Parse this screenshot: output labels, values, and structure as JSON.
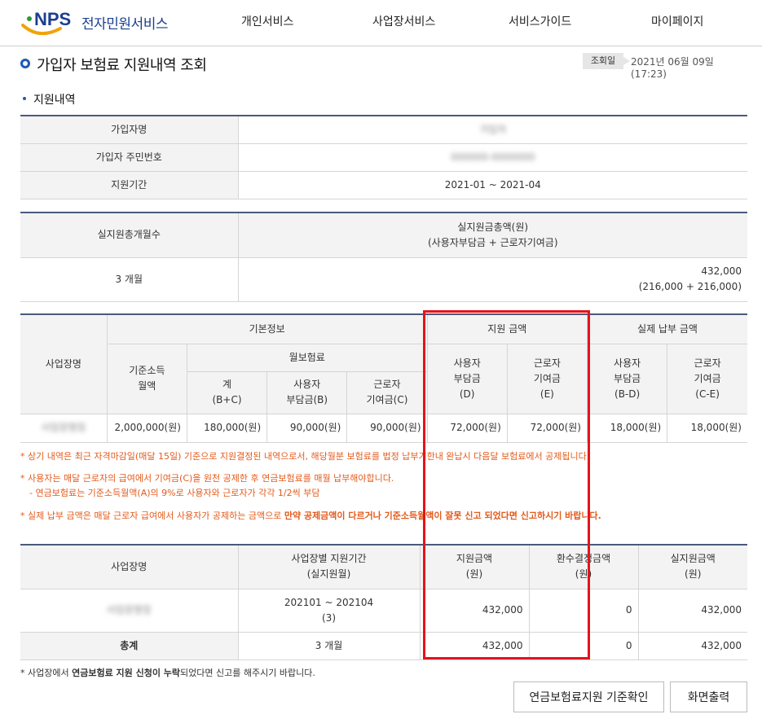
{
  "header": {
    "logo_text": "NPS",
    "service_name": "전자민원서비스",
    "nav": [
      "개인서비스",
      "사업장서비스",
      "서비스가이드",
      "마이페이지"
    ]
  },
  "page": {
    "title": "가입자 보험료 지원내역 조회",
    "query_label": "조회일",
    "query_date": "2021년 06월 09일 (17:23)",
    "section_title": "지원내역"
  },
  "info": {
    "name_label": "가입자명",
    "name_value": "가입자",
    "id_label": "가입자 주민번호",
    "id_value": "000000-0000000",
    "period_label": "지원기간",
    "period_value": "2021-01 ~ 2021-04"
  },
  "summary": {
    "months_header": "실지원총개월수",
    "total_header_1": "실지원금총액(원)",
    "total_header_2": "(사용자부담금 + 근로자기여금)",
    "months_value": "3 개월",
    "total_value_1": "432,000",
    "total_value_2": "(216,000 + 216,000)"
  },
  "detail": {
    "h_workplace": "사업장명",
    "h_basic": "기본정보",
    "h_support": "지원 금액",
    "h_actual": "실제 납부 금액",
    "h_income_1": "기준소득",
    "h_income_2": "월액",
    "h_monthly": "월보험료",
    "h_total_1": "계",
    "h_total_2": "(B+C)",
    "h_employer_1": "사용자",
    "h_employer_2": "부담금(B)",
    "h_worker_1": "근로자",
    "h_worker_2": "기여금(C)",
    "h_sup_emp_1": "사용자",
    "h_sup_emp_2": "부담금",
    "h_sup_emp_3": "(D)",
    "h_sup_wrk_1": "근로자",
    "h_sup_wrk_2": "기여금",
    "h_sup_wrk_3": "(E)",
    "h_act_emp_1": "사용자",
    "h_act_emp_2": "부담금",
    "h_act_emp_3": "(B-D)",
    "h_act_wrk_1": "근로자",
    "h_act_wrk_2": "기여금",
    "h_act_wrk_3": "(C-E)",
    "row": {
      "workplace": "사업장명칭",
      "income": "2,000,000(원)",
      "total": "180,000(원)",
      "employer": "90,000(원)",
      "worker": "90,000(원)",
      "sup_emp": "72,000(원)",
      "sup_wrk": "72,000(원)",
      "act_emp": "18,000(원)",
      "act_wrk": "18,000(원)"
    }
  },
  "notes": {
    "n1": "* 상기 내역은 최근 자격마감일(매달 15일) 기준으로 지원결정된 내역으로서, 해당월분 보험료를 법정 납부기한내 완납시 다음달 보험료에서 공제됩니다.",
    "n2": "* 사용자는 매달 근로자의 급여에서 기여금(C)을 원천 공제한 후 연금보험료를 매월 납부해야합니다.",
    "n3": "- 연금보험료는 기준소득월액(A)의 9%로 사용자와 근로자가 각각 1/2씩 부담",
    "n4_a": "* 실제 납부 금액은 매달 근로자 급여에서 사용자가 공제하는 금액으로 ",
    "n4_b": "만약 공제금액이 다르거나 기준소득월액이 잘못 신고 되었다면 신고하시기 바랍니다.",
    "n5_a": "* 사업장에서 ",
    "n5_b": "연금보험료 지원 신청이 누락",
    "n5_c": "되었다면 신고를 해주시기 바랍니다."
  },
  "by_workplace": {
    "h_workplace": "사업장명",
    "h_period_1": "사업장별 지원기간",
    "h_period_2": "(실지원월)",
    "h_support_1": "지원금액",
    "h_support_2": "(원)",
    "h_refund_1": "환수결정금액",
    "h_refund_2": "(원)",
    "h_actual_1": "실지원금액",
    "h_actual_2": "(원)",
    "row": {
      "workplace": "사업장명칭",
      "period_1": "202101 ~ 202104",
      "period_2": "(3)",
      "support": "432,000",
      "refund": "0",
      "actual": "432,000"
    },
    "total": {
      "label": "총계",
      "period": "3 개월",
      "support": "432,000",
      "refund": "0",
      "actual": "432,000"
    }
  },
  "buttons": {
    "criteria": "연금보험료지원 기준확인",
    "print": "화면출력"
  }
}
